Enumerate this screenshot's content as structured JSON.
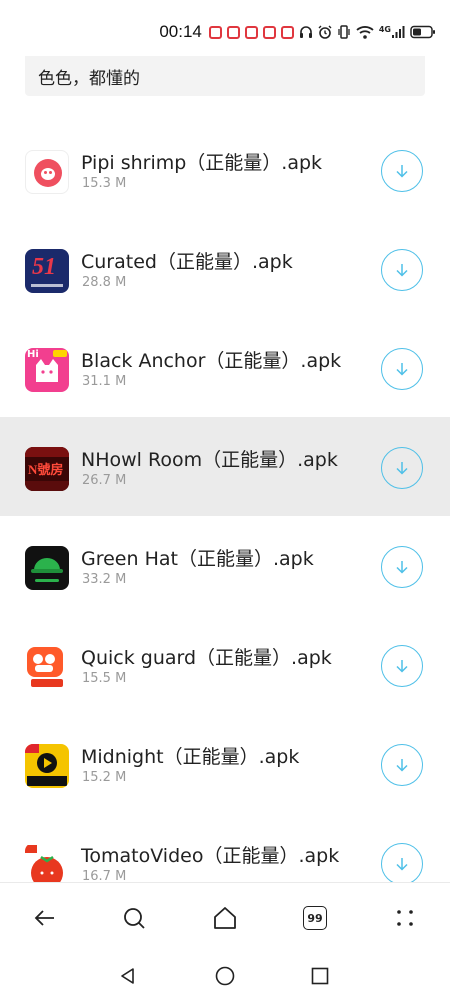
{
  "status_bar": {
    "time": "00:14",
    "network": "4G"
  },
  "search": {
    "text": "色色，都懂的"
  },
  "downloads": [
    {
      "name": "Pipi shrimp（正能量）.apk",
      "size": "15.3 M",
      "icon": "pipi-shrimp-app-icon"
    },
    {
      "name": "Curated（正能量）.apk",
      "size": "28.8 M",
      "icon": "curated-app-icon",
      "icon_text": "51"
    },
    {
      "name": "Black Anchor（正能量）.apk",
      "size": "31.1 M",
      "icon": "black-anchor-app-icon",
      "icon_text": "Hi"
    },
    {
      "name": "NHowl Room（正能量）.apk",
      "size": "26.7 M",
      "icon": "nhowl-room-app-icon",
      "icon_text": "N號房"
    },
    {
      "name": "Green Hat（正能量）.apk",
      "size": "33.2 M",
      "icon": "green-hat-app-icon"
    },
    {
      "name": "Quick guard（正能量）.apk",
      "size": "15.5 M",
      "icon": "quick-guard-app-icon"
    },
    {
      "name": "Midnight（正能量）.apk",
      "size": "15.2 M",
      "icon": "midnight-app-icon"
    },
    {
      "name": "TomatoVideo（正能量）.apk",
      "size": "16.7 M",
      "icon": "tomato-video-app-icon"
    }
  ],
  "bottom_nav": {
    "tabs_count": "99"
  },
  "colors": {
    "accent": "#4fc0e8",
    "selected_row": "#ebebeb",
    "notification_red": "#e0373f"
  }
}
